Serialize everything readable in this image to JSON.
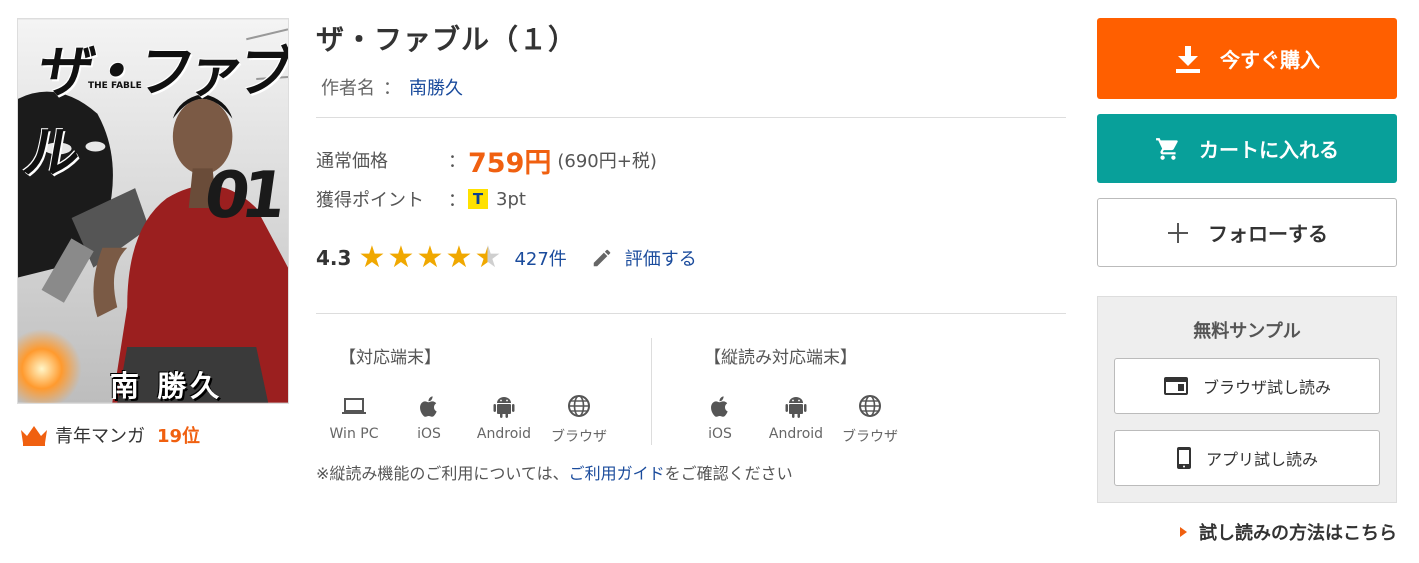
{
  "book": {
    "cover_title": "ザ・ファブル",
    "cover_subtitle": "THE FABLE",
    "cover_volume": "01",
    "cover_author": "南 勝久",
    "title": "ザ・ファブル（１）",
    "author_label": "作者名",
    "author_colon": "：",
    "author_name": "南勝久"
  },
  "ranking": {
    "genre": "青年マンガ",
    "position": "19位",
    "icon": "crown-icon"
  },
  "price": {
    "label": "通常価格",
    "colon": "：",
    "value": "759円",
    "tax_note": "(690円+税)"
  },
  "points": {
    "label": "獲得ポイント",
    "colon": "：",
    "icon_letter": "T",
    "value": "3pt"
  },
  "rating": {
    "score": "4.3",
    "stars": 4.3,
    "max_stars": 5,
    "count": "427件",
    "rate_label": "評価する"
  },
  "devices": {
    "supported_header": "【対応端末】",
    "supported": [
      {
        "label": "Win PC",
        "icon": "laptop-icon"
      },
      {
        "label": "iOS",
        "icon": "apple-icon"
      },
      {
        "label": "Android",
        "icon": "android-icon"
      },
      {
        "label": "ブラウザ",
        "icon": "globe-icon"
      }
    ],
    "vertical_header": "【縦読み対応端末】",
    "vertical": [
      {
        "label": "iOS",
        "icon": "apple-icon"
      },
      {
        "label": "Android",
        "icon": "android-icon"
      },
      {
        "label": "ブラウザ",
        "icon": "globe-icon"
      }
    ],
    "note_prefix": "※縦読み機能のご利用については、",
    "note_link": "ご利用ガイド",
    "note_suffix": "をご確認ください"
  },
  "actions": {
    "buy_now": "今すぐ購入",
    "add_to_cart": "カートに入れる",
    "follow": "フォローする"
  },
  "sample": {
    "header": "無料サンプル",
    "browser": "ブラウザ試し読み",
    "app": "アプリ試し読み",
    "howto": "試し読みの方法はこちら"
  },
  "colors": {
    "accent_orange": "#ff5f00",
    "teal": "#08a09a",
    "link_blue": "#1a4b9c",
    "star": "#f0a800"
  }
}
